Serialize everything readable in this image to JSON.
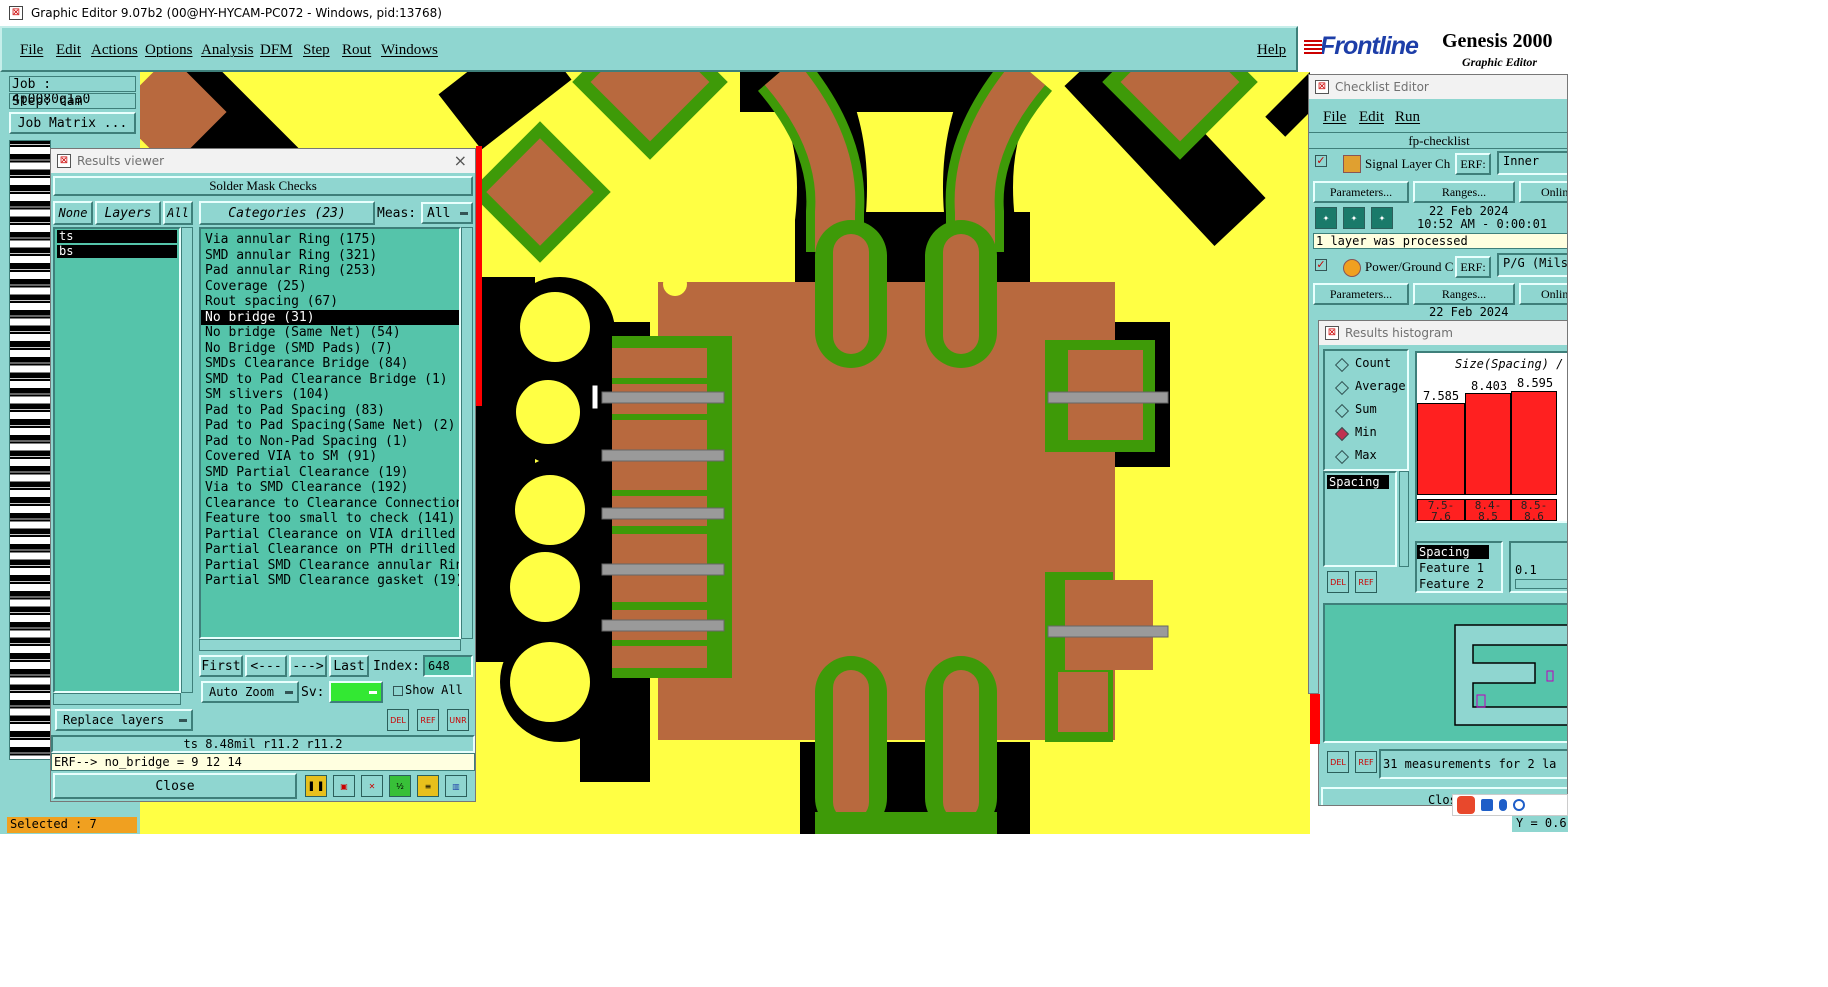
{
  "window": {
    "title": "Graphic Editor 9.07b2 (00@HY-HYCAM-PC072 - Windows, pid:13768)"
  },
  "menu": {
    "items": [
      "File",
      "Edit",
      "Actions",
      "Options",
      "Analysis",
      "DFM",
      "Step",
      "Rout",
      "Windows"
    ],
    "help": "Help"
  },
  "brand": {
    "logo": "Frontline",
    "product": "Genesis 2000",
    "subtitle": "Graphic Editor"
  },
  "job": {
    "job": "Job : 4p0080q1a0",
    "step": "Step: cam",
    "matrix_button": "Job Matrix ...",
    "selected": "Selected : 7"
  },
  "results_viewer": {
    "title": "Results viewer",
    "header": "Solder Mask Checks",
    "layer_buttons": [
      "None",
      "Layers",
      "All"
    ],
    "categories_button": "Categories (23)",
    "meas_label": "Meas:",
    "meas_value": "All",
    "layers": [
      "ts",
      "bs"
    ],
    "categories": [
      "Via annular Ring (175)",
      "SMD annular Ring (321)",
      "Pad annular Ring (253)",
      "Coverage (25)",
      "Rout spacing (67)",
      "No bridge (31)",
      "No bridge (Same Net) (54)",
      "No Bridge (SMD Pads) (7)",
      "SMDs Clearance Bridge (84)",
      "SMD to Pad Clearance Bridge (1)",
      "SM slivers (104)",
      "Pad to Pad Spacing (83)",
      "Pad to Pad Spacing(Same Net) (2)",
      "Pad to Non-Pad Spacing (1)",
      "Covered VIA to SM (91)",
      "SMD Partial Clearance (19)",
      "Via to SMD Clearance (192)",
      "Clearance to Clearance Connection",
      "Feature too small to check (141)",
      "Partial Clearance on VIA drilled",
      "Partial Clearance on PTH drilled",
      "Partial SMD Clearance annular Rin",
      "Partial SMD Clearance gasket (19)"
    ],
    "selected_index": 5,
    "nav": [
      "First",
      "<---",
      "--->",
      "Last"
    ],
    "index_label": "Index:",
    "index_value": "648",
    "auto_zoom": "Auto Zoom",
    "sv_label": "Sv:",
    "show_all": "Show All",
    "replace_layers": "Replace layers",
    "icon_labels": [
      "DEL",
      "REF",
      "UNR"
    ],
    "status": "ts 8.48mil   r11.2   r11.2",
    "erf": "ERF--> no_bridge = 9 12 14",
    "close": "Close"
  },
  "checklist": {
    "title": "Checklist Editor",
    "menu": [
      "File",
      "Edit",
      "Run"
    ],
    "name": "fp-checklist",
    "items": [
      {
        "name": "Signal Layer Ch",
        "erf_label": "ERF:",
        "erf_value": "Inner",
        "params": "Parameters...",
        "ranges": "Ranges...",
        "online": "Onlin",
        "date": "22 Feb 2024",
        "time": "10:52 AM - 0:00:01",
        "msg": "1 layer was processed"
      },
      {
        "name": "Power/Ground C",
        "erf_label": "ERF:",
        "erf_value": "P/G (Mils",
        "params": "Parameters...",
        "ranges": "Ranges...",
        "online": "Onlin",
        "date": "22 Feb 2024"
      }
    ]
  },
  "histogram": {
    "title": "Results histogram",
    "options": [
      "Count",
      "Average",
      "Sum",
      "Min",
      "Max"
    ],
    "selected_option": "Min",
    "list_item": "Spacing",
    "chart_title": "Size(Spacing) /",
    "bar_values": [
      "7.585",
      "8.403",
      "8.595"
    ],
    "bins": [
      "7.5-\n7.6",
      "8.4-\n8.5",
      "8.5-\n8.6"
    ],
    "info": [
      "Spacing",
      "Feature 1",
      "Feature 2"
    ],
    "step_value": "0.1",
    "footer": "31 measurements for 2 la",
    "close": "Close",
    "y_readout": "Y = 0.6"
  },
  "colors": {
    "board_bg": "#ffff44",
    "copper": "#b8693e",
    "mask": "#3e9a08",
    "panel": "#8fd6d0",
    "panel_dark": "#55c4aa"
  }
}
